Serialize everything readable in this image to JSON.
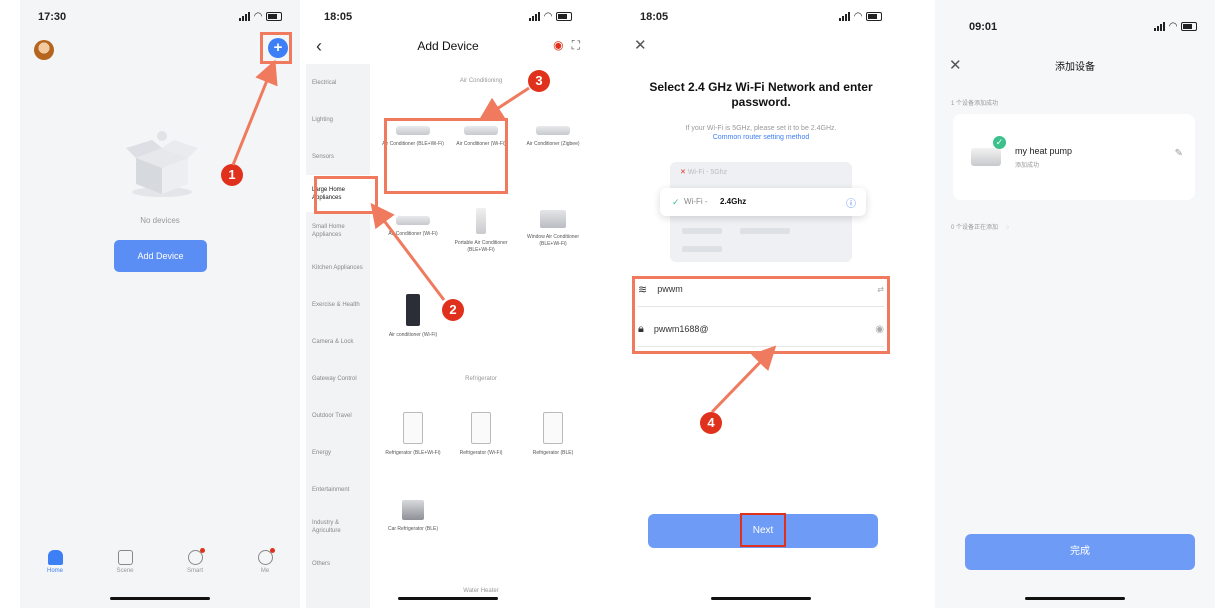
{
  "phone1": {
    "time": "17:30",
    "empty_text": "No devices",
    "add_device_label": "Add Device",
    "tabs": [
      {
        "label": "Home",
        "icon": "home-icon"
      },
      {
        "label": "Scene",
        "icon": "scene-icon"
      },
      {
        "label": "Smart",
        "icon": "smart-icon"
      },
      {
        "label": "Me",
        "icon": "me-icon"
      }
    ]
  },
  "phone2": {
    "time": "18:05",
    "title": "Add Device",
    "categories": [
      "Electrical",
      "Lighting",
      "Sensors",
      "Large Home Appliances",
      "Small Home Appliances",
      "Kitchen Appliances",
      "Exercise & Health",
      "Camera & Lock",
      "Gateway Control",
      "Outdoor Travel",
      "Energy",
      "Entertainment",
      "Industry & Agriculture",
      "Others"
    ],
    "section_air": "Air Conditioning",
    "section_fridge": "Refrigerator",
    "section_water": "Water Heater",
    "devices_air": [
      "Air Conditioner (BLE+Wi-Fi)",
      "Air Conditioner (Wi-Fi)",
      "Air Conditioner (Zigbee)",
      "Air Conditioner (Wi-Fi)",
      "Portable Air Conditioner (BLE+Wi-Fi)",
      "Window Air Conditioner (BLE+Wi-Fi)",
      "Air conditioner (Wi-Fi)"
    ],
    "devices_fridge": [
      "Refrigerator (BLE+Wi-Fi)",
      "Refrigerator (Wi-Fi)",
      "Refrigerator (BLE)",
      "Car Refrigerator (BLE)"
    ]
  },
  "phone3": {
    "time": "18:05",
    "heading": "Select 2.4 GHz Wi-Fi Network and enter password.",
    "subtext": "If your Wi-Fi is 5GHz, please set it to be 2.4GHz.",
    "link": "Common router setting method",
    "net_5g": "Wi-Fi - 5Ghz",
    "net_24_prefix": "Wi-Fi - ",
    "net_24": "2.4Ghz",
    "ssid": "pwwm",
    "password": "pwwm1688@",
    "next_label": "Next"
  },
  "phone4": {
    "time": "09:01",
    "title": "添加设备",
    "added_count": "1 个设备添加成功",
    "device_name": "my heat pump",
    "device_status": "添加成功",
    "adding_count": "0 个设备正在添加",
    "done_label": "完成"
  },
  "badges": [
    "1",
    "2",
    "3",
    "4"
  ],
  "colors": {
    "accent": "#3d7ff5",
    "highlight": "#f07a5e",
    "badge": "#e0311c"
  }
}
